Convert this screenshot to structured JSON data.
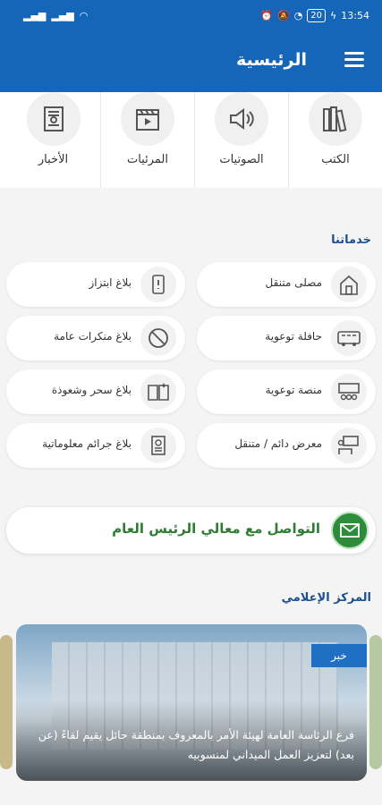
{
  "status": {
    "time": "13:54",
    "battery": "20"
  },
  "header": {
    "title": "الرئيسية"
  },
  "categories": [
    {
      "label": "الكتب",
      "icon": "books-icon"
    },
    {
      "label": "الصوتيات",
      "icon": "speaker-icon"
    },
    {
      "label": "المرئيات",
      "icon": "clapperboard-icon"
    },
    {
      "label": "الأخبار",
      "icon": "newspaper-icon"
    }
  ],
  "services_title": "خدماتنا",
  "services": [
    {
      "label": "مصلى متنقل",
      "icon": "mosque-icon"
    },
    {
      "label": "بلاغ ابتزاز",
      "icon": "phone-alert-icon"
    },
    {
      "label": "حافلة توعوية",
      "icon": "bus-icon"
    },
    {
      "label": "بلاغ منكرات عامة",
      "icon": "prohibited-icon"
    },
    {
      "label": "منصة توعوية",
      "icon": "platform-icon"
    },
    {
      "label": "بلاغ سحر وشعوذة",
      "icon": "magic-book-icon"
    },
    {
      "label": "معرض دائم / متنقل",
      "icon": "exhibition-icon"
    },
    {
      "label": "بلاغ جرائم معلوماتية",
      "icon": "cyber-crime-icon"
    }
  ],
  "contact": {
    "label": "التواصل مع معالي الرئيس العام"
  },
  "media_title": "المركز الإعلامي",
  "news": {
    "badge": "خبر",
    "headline": "فرع الرئاسة العامة لهيئة الأمر بالمعروف بمنطقة حائل يقيم لقاءً (عن بعد) لتعزيز العمل الميداني لمنسوبيه"
  }
}
